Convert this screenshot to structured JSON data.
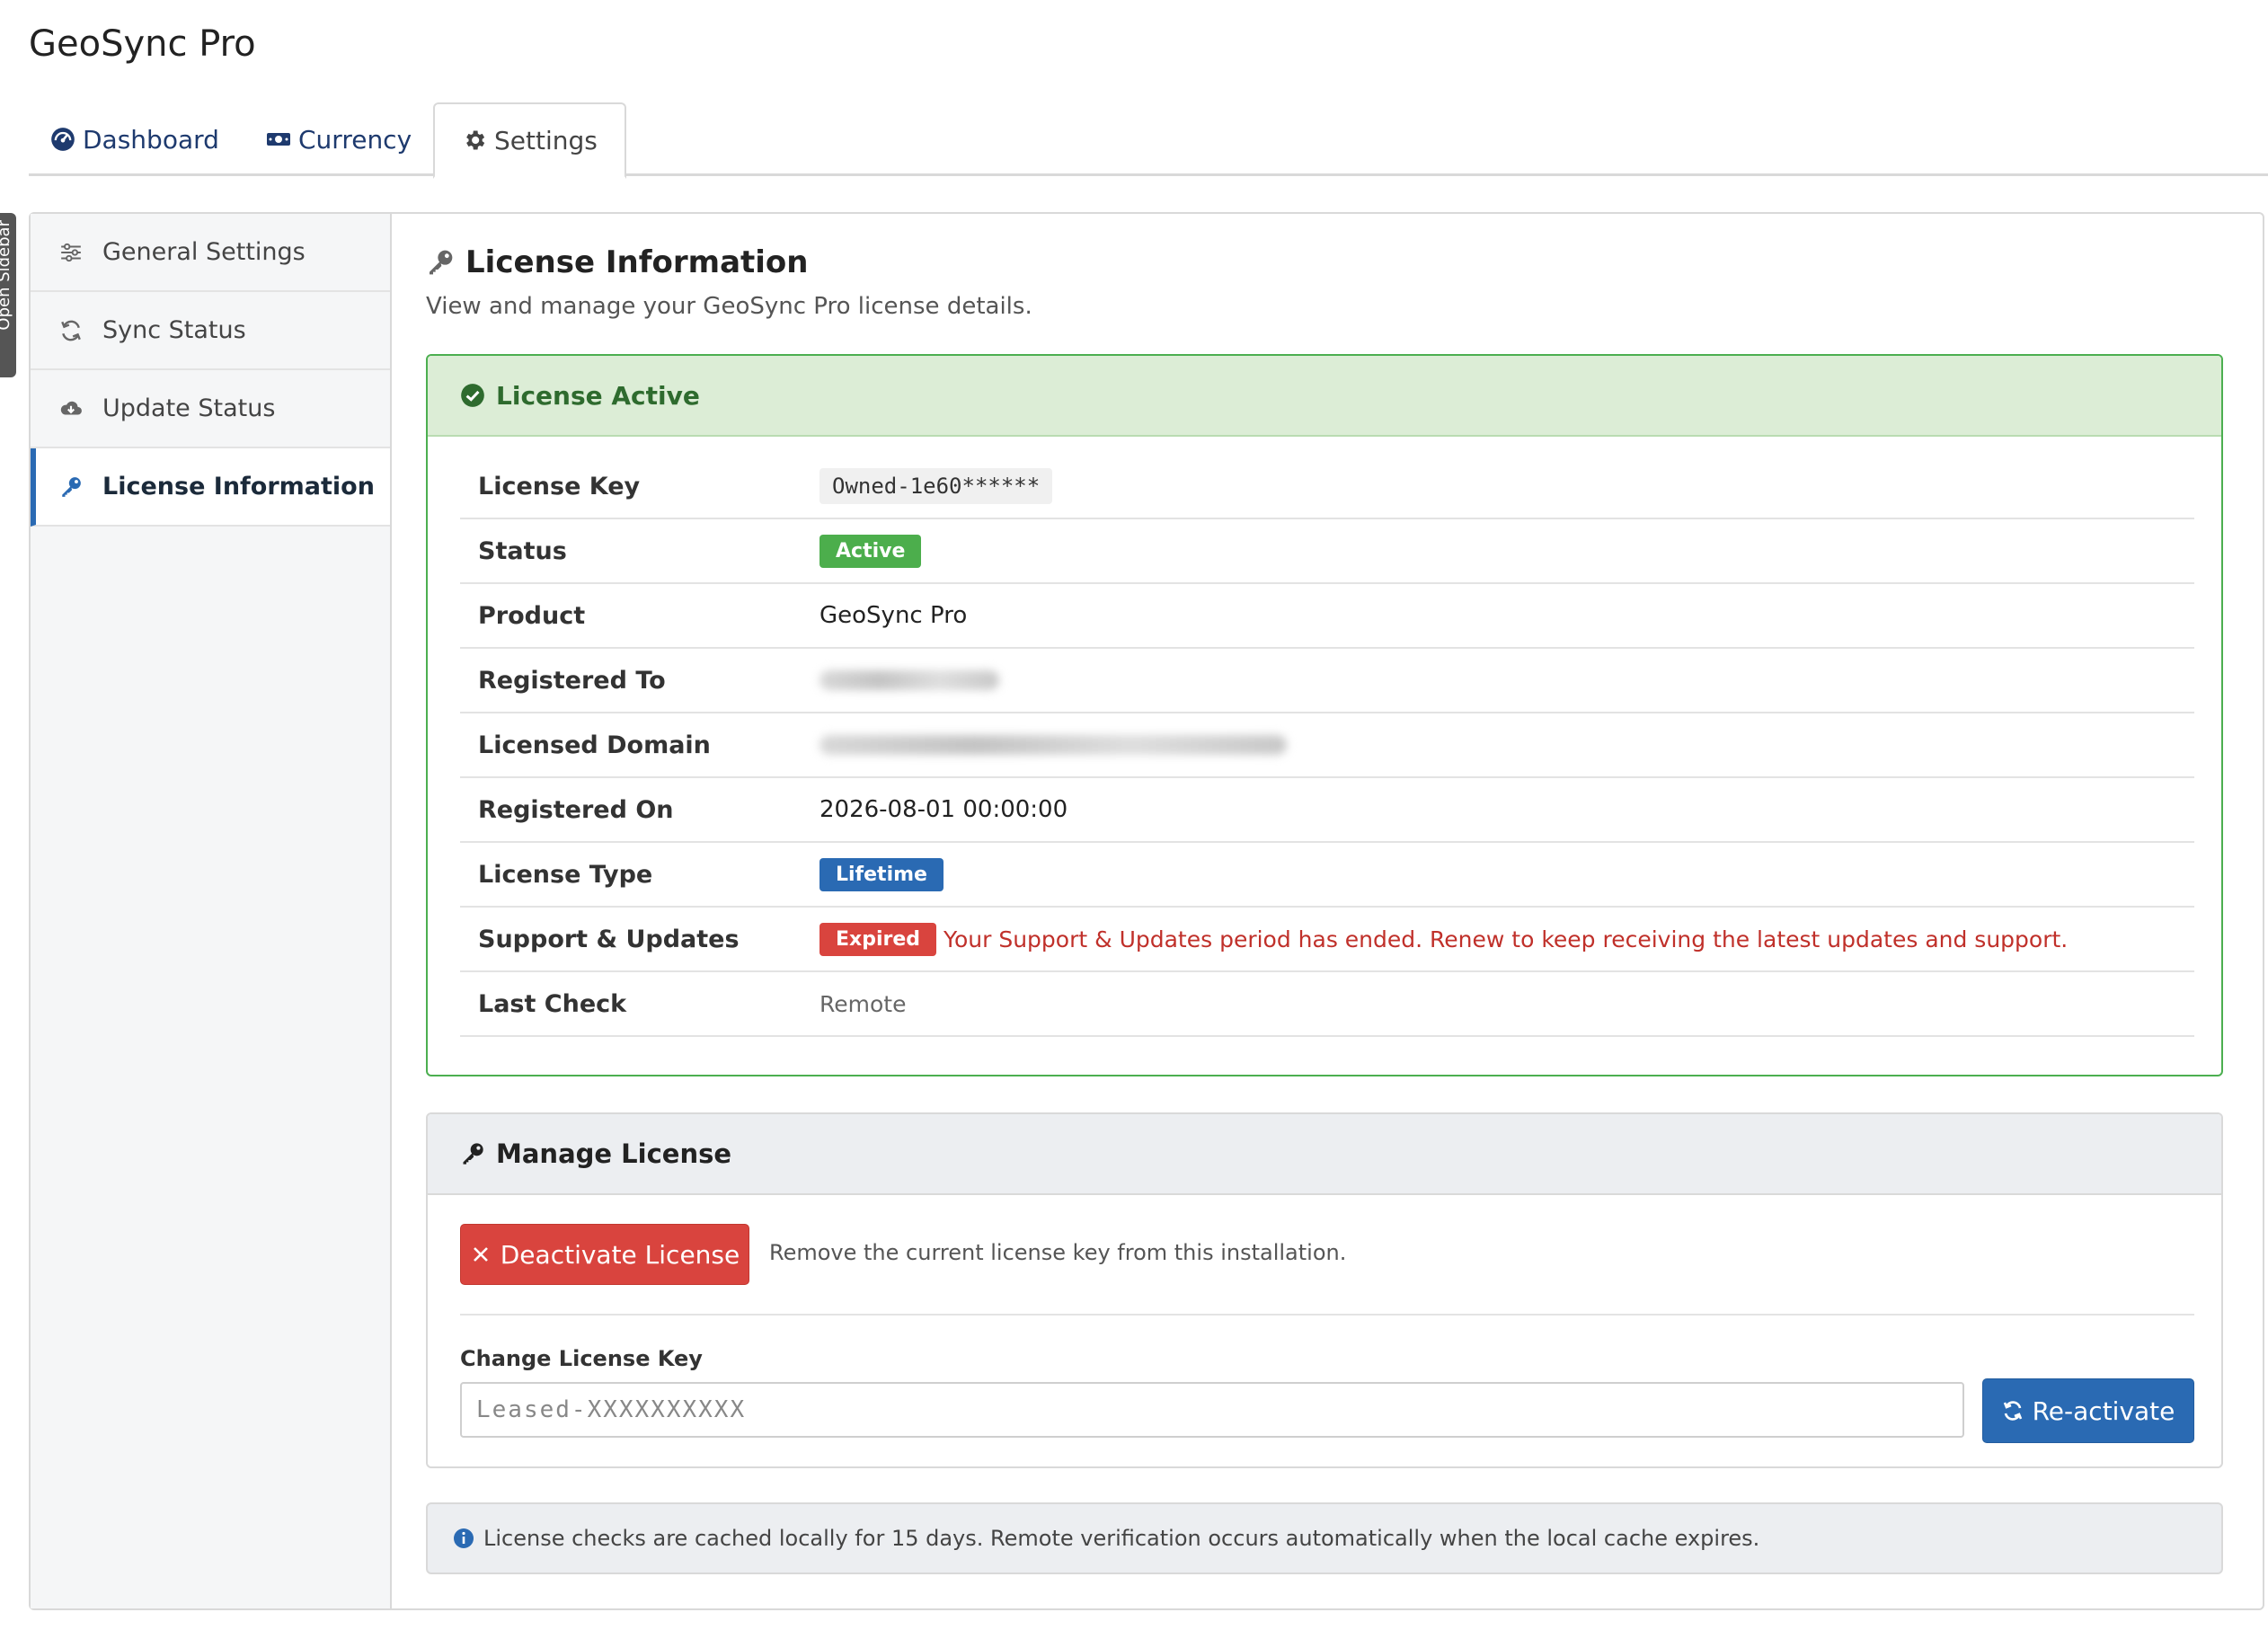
{
  "app": {
    "title": "GeoSync Pro"
  },
  "sidebar_toggle": {
    "label": "Open Sidebar"
  },
  "tabs": [
    {
      "label": "Dashboard",
      "icon": "dashboard-icon"
    },
    {
      "label": "Currency",
      "icon": "money-icon"
    },
    {
      "label": "Settings",
      "icon": "gear-icon",
      "active": true
    }
  ],
  "nav": {
    "items": [
      {
        "label": "General Settings",
        "icon": "sliders-icon"
      },
      {
        "label": "Sync Status",
        "icon": "sync-icon"
      },
      {
        "label": "Update Status",
        "icon": "cloud-download-icon"
      },
      {
        "label": "License Information",
        "icon": "key-icon",
        "active": true
      }
    ]
  },
  "section": {
    "title": "License Information",
    "subtitle": "View and manage your GeoSync Pro license details."
  },
  "license_card": {
    "header": "License Active",
    "rows": {
      "key": {
        "label": "License Key",
        "value": "Owned-1e60******"
      },
      "status": {
        "label": "Status",
        "value": "Active"
      },
      "product": {
        "label": "Product",
        "value": "GeoSync Pro"
      },
      "registered_to": {
        "label": "Registered To"
      },
      "domain": {
        "label": "Licensed Domain"
      },
      "registered_on": {
        "label": "Registered On",
        "value": "2026-08-01 00:00:00"
      },
      "type": {
        "label": "License Type",
        "value": "Lifetime"
      },
      "support": {
        "label": "Support & Updates",
        "badge": "Expired",
        "message": "Your Support & Updates period has ended. Renew to keep receiving the latest updates and support."
      },
      "last_check": {
        "label": "Last Check",
        "value": "Remote"
      }
    }
  },
  "manage": {
    "title": "Manage License",
    "deactivate_label": "Deactivate License",
    "deactivate_note": "Remove the current license key from this installation.",
    "change_label": "Change License Key",
    "input_placeholder": "Leased-XXXXXXXXXX",
    "reactivate_label": "Re-activate"
  },
  "info": {
    "text": "License checks are cached locally for 15 days. Remote verification occurs automatically when the local cache expires."
  },
  "colors": {
    "accent_blue": "#2a6ab3",
    "success_green": "#4cae4c",
    "danger_red": "#d9443e"
  }
}
